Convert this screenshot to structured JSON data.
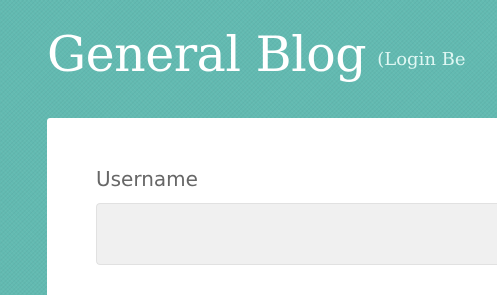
{
  "header": {
    "title": "General Blog",
    "login_link": "(Login Be"
  },
  "login_form": {
    "username_label": "Username",
    "username_value": "",
    "username_placeholder": ""
  },
  "colors": {
    "background": "#62bab1",
    "panel": "#ffffff",
    "input_background": "#f0f0f0",
    "label_text": "#676767"
  }
}
